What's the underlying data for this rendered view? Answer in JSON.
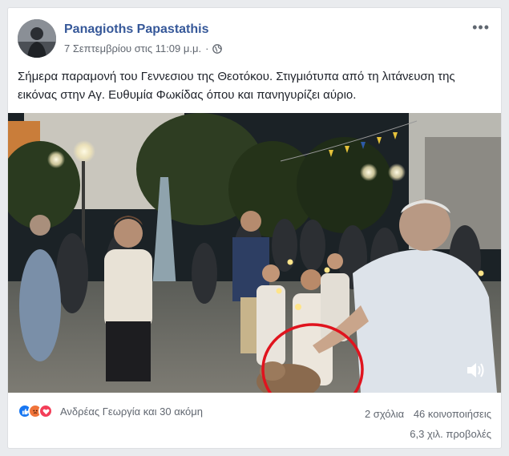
{
  "post": {
    "author": "Panagioths Papastathis",
    "timestamp": "7 Σεπτεμβρίου στις 11:09 μ.μ.",
    "separator": "·",
    "privacy_icon": "globe-icon",
    "more_icon": "•••",
    "text": "Σήμερα παραμονή του Γεννεσιου της Θεοτόκου. Στιγμιότυπα από τη λιτάνευση της εικόνας στην Αγ. Ευθυμία Φωκίδας όπου και πανηγυρίζει αύριο."
  },
  "media": {
    "kind": "video",
    "volume_icon": "volume-icon",
    "annotation_color": "#e0141e"
  },
  "footer": {
    "reaction_icons": [
      "like-icon",
      "angry-icon",
      "love-icon"
    ],
    "reactors": "Ανδρέας Γεωργία και 30 ακόμη",
    "comments": "2 σχόλια",
    "shares": "46 κοινοποιήσεις",
    "views": "6,3 χιλ. προβολές"
  },
  "colors": {
    "author": "#365899",
    "meta": "#616770",
    "like": "#1877f2",
    "angry": "#f0743a",
    "love": "#f33e58"
  }
}
